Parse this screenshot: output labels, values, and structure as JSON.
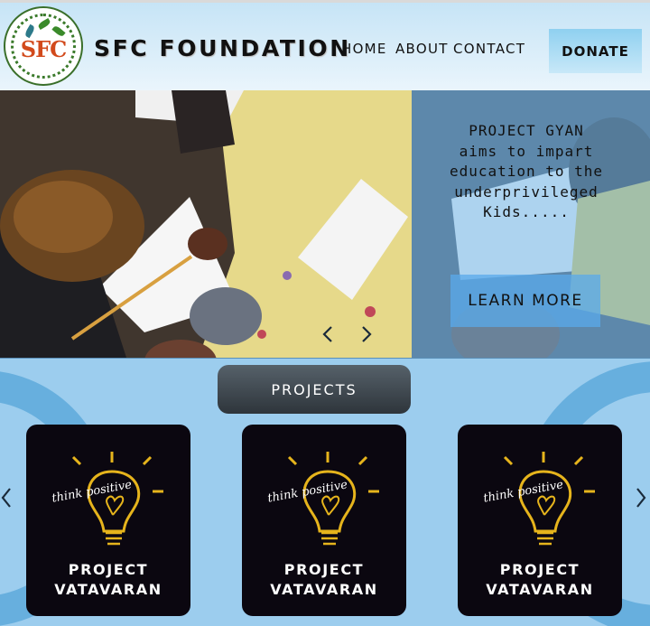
{
  "header": {
    "logo_text": "SFC",
    "brand": "SFC FOUNDATION",
    "nav": [
      "HOME",
      "ABOUT",
      "CONTACT"
    ],
    "donate_label": "DONATE"
  },
  "hero": {
    "text": "PROJECT GYAN aims to impart education to the underprivileged Kids.....",
    "button_label": "LEARN MORE"
  },
  "projects": {
    "button_label": "PROJECTS",
    "cards": [
      {
        "title": "PROJECT VATAVARAN",
        "art_text": "think positive"
      },
      {
        "title": "PROJECT VATAVARAN",
        "art_text": "think positive"
      },
      {
        "title": "PROJECT VATAVARAN",
        "art_text": "think positive"
      }
    ]
  },
  "colors": {
    "header_bg": "#c6e4f6",
    "donate_bg": "#8fd0f0",
    "projects_bg": "#9ccdee",
    "card_bg": "#0b0710",
    "bulb": "#e6b41c"
  }
}
